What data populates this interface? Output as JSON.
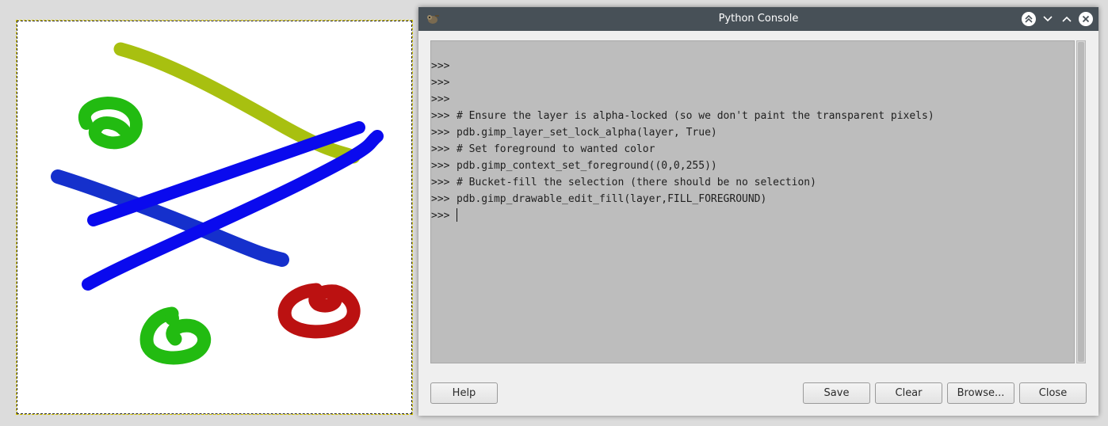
{
  "window": {
    "title": "Python Console",
    "titlebar_color": "#475057",
    "controls": [
      "keep-above-icon",
      "minimize-icon",
      "maximize-icon",
      "close-icon"
    ]
  },
  "console": {
    "prompt": ">>>",
    "lines": [
      {
        "prompt": ">>>",
        "text": ""
      },
      {
        "prompt": ">>>",
        "text": ""
      },
      {
        "prompt": ">>>",
        "text": ""
      },
      {
        "prompt": ">>>",
        "text": "# Ensure the layer is alpha-locked (so we don't paint the transparent pixels)"
      },
      {
        "prompt": ">>>",
        "text": "pdb.gimp_layer_set_lock_alpha(layer, True)"
      },
      {
        "prompt": ">>>",
        "text": "# Set foreground to wanted color"
      },
      {
        "prompt": ">>>",
        "text": "pdb.gimp_context_set_foreground((0,0,255))"
      },
      {
        "prompt": ">>>",
        "text": "# Bucket-fill the selection (there should be no selection)"
      },
      {
        "prompt": ">>>",
        "text": "pdb.gimp_drawable_edit_fill(layer,FILL_FOREGROUND)"
      },
      {
        "prompt": ">>>",
        "text": ""
      }
    ],
    "background": "#bdbdbd"
  },
  "buttons": {
    "help": "Help",
    "save": "Save",
    "clear": "Clear",
    "browse": "Browse...",
    "close": "Close"
  },
  "canvas": {
    "background": "#ffffff",
    "stroke_colors": {
      "olive": "#a8c010",
      "green": "#22bb11",
      "navy": "#1530cc",
      "blue": "#0a0aee",
      "red": "#bb1111"
    }
  }
}
